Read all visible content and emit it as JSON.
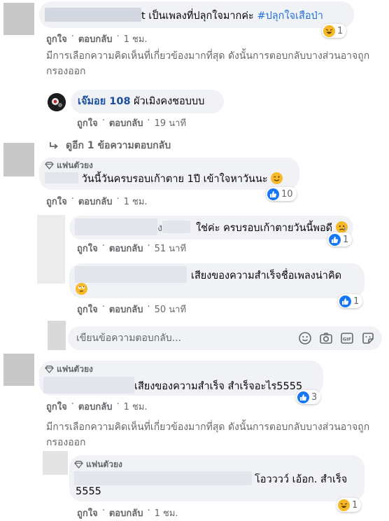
{
  "comments": [
    {
      "text": "เป็นเพลงที่ปลุกใจมากค่ะ",
      "hashtag": "#ปลุกใจเสือป่า",
      "partial_name_char": "t",
      "actions": {
        "like": "ถูกใจ",
        "reply": "ตอบกลับ",
        "time": "1 ชม."
      },
      "reaction_count": "1"
    },
    {
      "badge": "แฟนตัวยง",
      "text": "วันนี้วันครบรอบเก้าตาย 1ปี เข้าใจหาวันนะ",
      "actions": {
        "like": "ถูกใจ",
        "reply": "ตอบกลับ",
        "time": "1 ชม."
      },
      "reaction_count": "10"
    },
    {
      "badge": "แฟนตัวยง",
      "text": "เสียงของความสำเร็จ สำเร็จอะไร5555",
      "actions": {
        "like": "ถูกใจ",
        "reply": "ตอบกลับ",
        "time": "1 ชม."
      },
      "reaction_count": "3"
    }
  ],
  "filter_note": "มีการเลือกความคิดเห็นที่เกี่ยวข้องมากที่สุด ดังนั้นการตอบกลับบางส่วนอาจถูกกรองออก",
  "replies": {
    "jemoy": {
      "name": "เจ๊มอย 108",
      "text": "ผัวเมิงคงชอบบบ",
      "actions": {
        "like": "ถูกใจ",
        "reply": "ตอบกลับ",
        "time": "19 นาที"
      }
    },
    "reply_a": {
      "partial_name_char": "ง",
      "text": "ใช่ค่ะ ครบรอบเก้าตายวันนี้พอดี",
      "actions": {
        "like": "ถูกใจ",
        "reply": "ตอบกลับ",
        "time": "51 นาที"
      },
      "reaction_count": "1"
    },
    "reply_b": {
      "text": "เสียงของความสำเร็จชื่อเพลงน่าคิด",
      "actions": {
        "like": "ถูกใจ",
        "reply": "ตอบกลับ",
        "time": "50 นาที"
      },
      "reaction_count": "1"
    },
    "reply_c": {
      "badge": "แฟนตัวยง",
      "text_line1": "โอวววว์ เอ้อก. สำเร็จ",
      "text_line2": "5555",
      "actions": {
        "like": "ถูกใจ",
        "reply": "ตอบกลับ",
        "time": "1 ชม."
      },
      "reaction_count": "1"
    }
  },
  "more_replies": "ดูอีก 1 ข้อความตอบกลับ",
  "reply_input": {
    "placeholder": "เขียนข้อความตอบกลับ..."
  },
  "icons": {
    "reply_arrow": "reply-arrow-icon",
    "badge": "diamond-badge-icon",
    "emoji": "emoji-icon",
    "camera": "camera-icon",
    "gif": "gif-icon",
    "sticker": "sticker-icon"
  },
  "colors": {
    "like": "#1877f2",
    "haha": "#f7b928",
    "bubble": "#f0f2f5",
    "meta": "#65676b"
  }
}
